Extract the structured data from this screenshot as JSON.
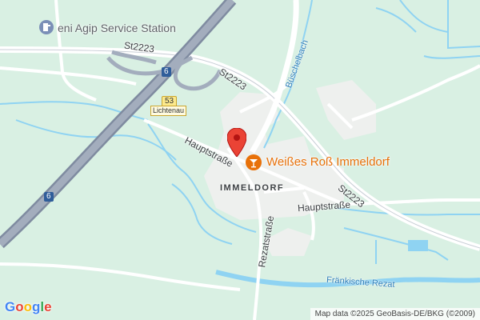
{
  "map": {
    "labels": {
      "agip": "eni Agip Service Station",
      "st2223_a": "St2223",
      "st2223_b": "St2223",
      "st2223_c": "St2223",
      "buschelbach": "Büschelbach",
      "hauptstrasse_a": "Hauptstraße",
      "hauptstrasse_b": "Hauptstraße",
      "immeldorf": "IMMELDORF",
      "rezatstrasse": "Rezatstraße",
      "frankische_rezat": "Fränkische Rezat"
    },
    "shields": {
      "a6_top": "6",
      "a6_bottom": "6",
      "b53": "53",
      "lichtenau": "Lichtenau"
    },
    "poi": {
      "name": "Weißes Roß Immeldorf",
      "icon": "cocktail-bar-icon",
      "color": "#e8710a"
    },
    "marker": {
      "icon": "map-pin-icon",
      "color": "#ea4335"
    },
    "logo": {
      "letters": [
        "G",
        "o",
        "o",
        "g",
        "l",
        "e"
      ],
      "colors": [
        "#4285f4",
        "#ea4335",
        "#fbbc05",
        "#4285f4",
        "#34a853",
        "#ea4335"
      ]
    },
    "attribution": "Map data ©2025 GeoBasis-DE/BKG (©2009)",
    "colors": {
      "land": "#d9f0e3",
      "water": "#8fd3f2",
      "motorway": "#8d99ad",
      "road": "#ffffff",
      "settlement": "#eef0ee"
    }
  }
}
